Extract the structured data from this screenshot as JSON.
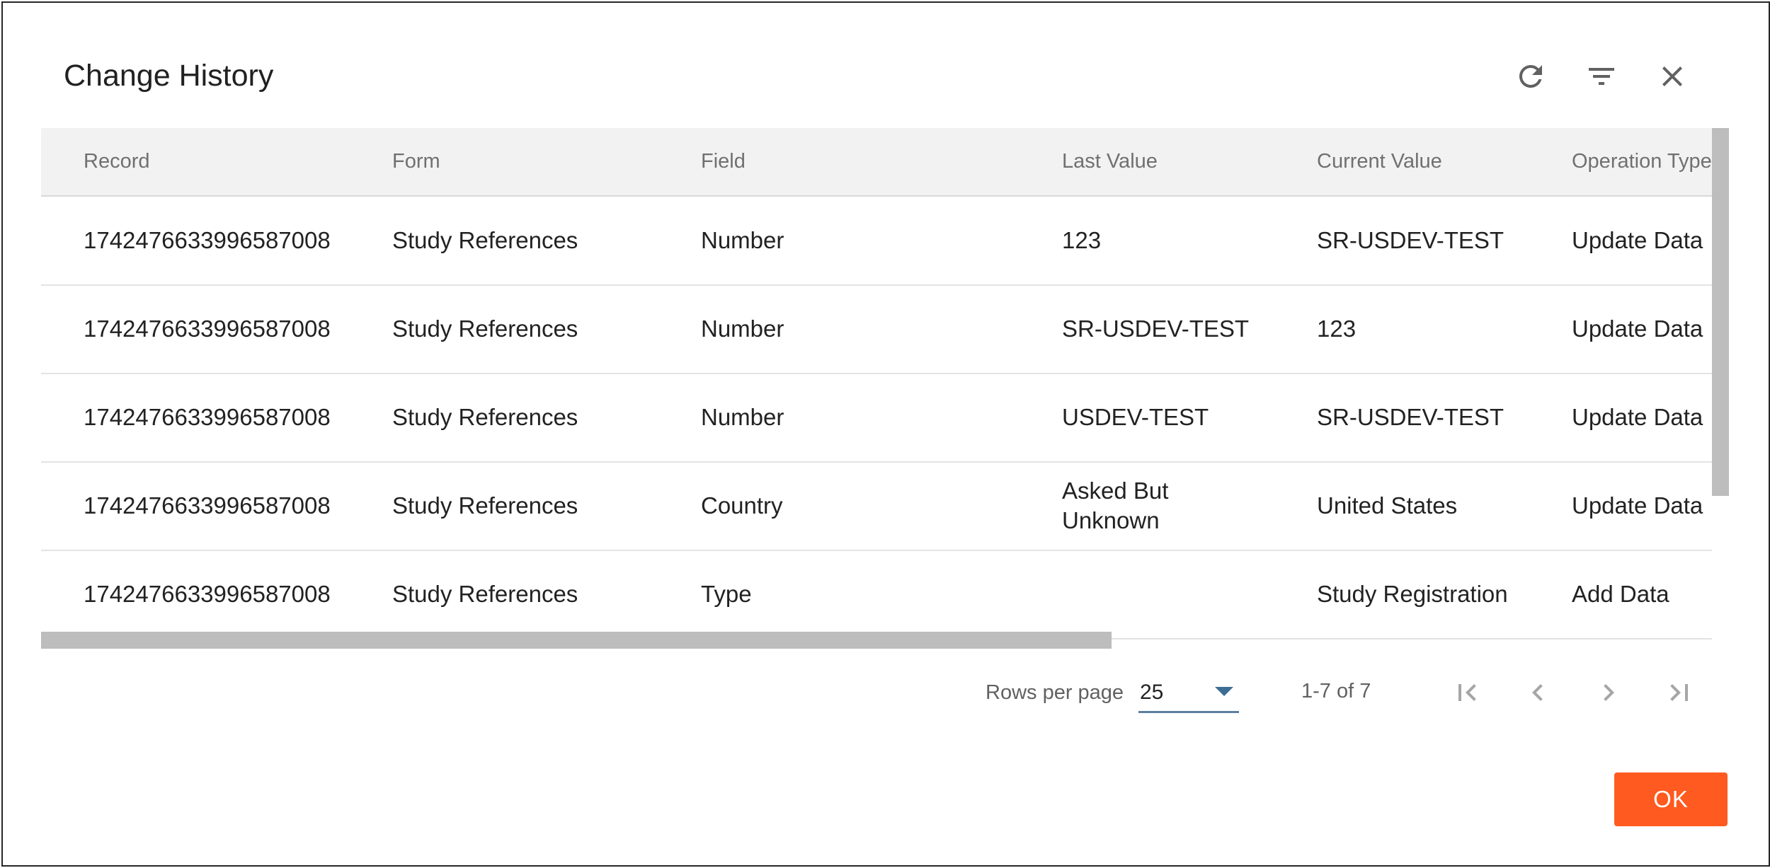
{
  "dialog": {
    "title": "Change History",
    "icons": {
      "refresh": "refresh-icon",
      "filter": "filter-icon",
      "close": "close-icon"
    }
  },
  "table": {
    "columns": [
      "Record",
      "Form",
      "Field",
      "Last Value",
      "Current Value",
      "Operation Type"
    ],
    "rows": [
      {
        "record": "1742476633996587008",
        "form": "Study References",
        "field": "Number",
        "last_value": "123",
        "current_value": "SR-USDEV-TEST",
        "operation_type": "Update Data"
      },
      {
        "record": "1742476633996587008",
        "form": "Study References",
        "field": "Number",
        "last_value": "SR-USDEV-TEST",
        "current_value": "123",
        "operation_type": "Update Data"
      },
      {
        "record": "1742476633996587008",
        "form": "Study References",
        "field": "Number",
        "last_value": "USDEV-TEST",
        "current_value": "SR-USDEV-TEST",
        "operation_type": "Update Data"
      },
      {
        "record": "1742476633996587008",
        "form": "Study References",
        "field": "Country",
        "last_value": "Asked But Unknown",
        "current_value": "United States",
        "operation_type": "Update Data"
      },
      {
        "record": "1742476633996587008",
        "form": "Study References",
        "field": "Type",
        "last_value": "",
        "current_value": "Study Registration",
        "operation_type": "Add Data"
      }
    ]
  },
  "pagination": {
    "rows_per_page_label": "Rows per page",
    "rows_per_page_value": "25",
    "range_text": "1-7 of 7",
    "icons": {
      "first": "first-page-icon",
      "prev": "chevron-left-icon",
      "next": "chevron-right-icon",
      "last": "last-page-icon"
    }
  },
  "footer": {
    "ok_label": "OK"
  },
  "colors": {
    "accent": "#ff5a1f",
    "header_bg": "#f2f2f2",
    "select_underline": "#5a7fa0"
  }
}
